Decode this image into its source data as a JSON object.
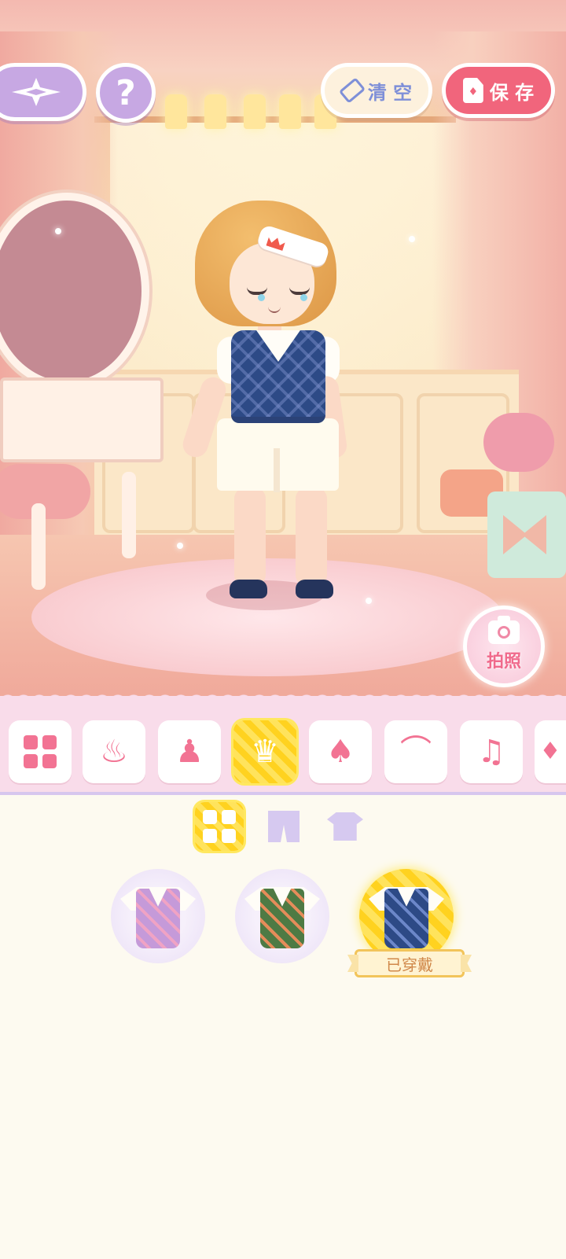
{
  "top_bar": {
    "help_label": "?",
    "clear_label": "清 空",
    "save_label": "保 存"
  },
  "photo_button": {
    "label": "拍照"
  },
  "category_tabs": [
    {
      "icon": "grid-icon",
      "active": false
    },
    {
      "icon": "outfit-set-icon",
      "active": false
    },
    {
      "icon": "head-accessory-icon",
      "active": false
    },
    {
      "icon": "top-clothing-icon",
      "active": true
    },
    {
      "icon": "dress-icon",
      "active": false
    },
    {
      "icon": "shoes-icon",
      "active": false
    },
    {
      "icon": "socks-icon",
      "active": false
    },
    {
      "icon": "more-icon",
      "active": false
    }
  ],
  "sub_tabs": [
    {
      "icon": "grid-icon",
      "active": true
    },
    {
      "icon": "pants-icon",
      "active": false
    },
    {
      "icon": "shirt-icon",
      "active": false
    }
  ],
  "items": [
    {
      "icon": "purple-argyle-vest-icon",
      "color": "#c59ad9",
      "selected": false
    },
    {
      "icon": "green-argyle-vest-icon",
      "color": "#4e7a44",
      "selected": false
    },
    {
      "icon": "navy-argyle-vest-icon",
      "color": "#2d4a86",
      "selected": true,
      "badge": "已穿戴"
    }
  ],
  "colors": {
    "accent_pink": "#f1657c",
    "lavender": "#c7a8e3",
    "selected_yellow": "#ffd21f"
  }
}
